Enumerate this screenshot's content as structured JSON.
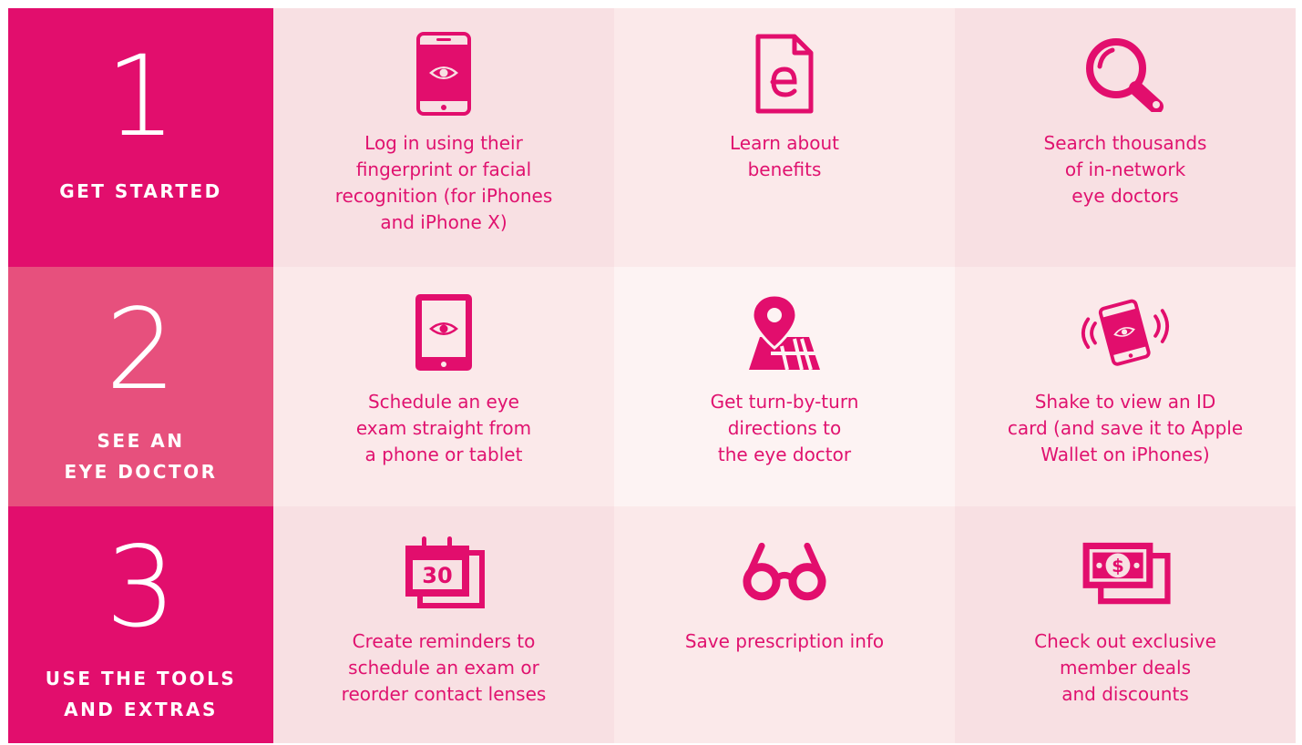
{
  "colors": {
    "accent": "#e20e6d",
    "step_bg_dark": "#e20e6d",
    "step_bg_mid": "#e7507d",
    "cell_a": "#f8e0e3",
    "cell_b": "#fbe9ea",
    "cell_c": "#fdf3f3"
  },
  "steps": [
    {
      "number": "1",
      "title": "GET STARTED"
    },
    {
      "number": "2",
      "title": "SEE AN\nEYE DOCTOR"
    },
    {
      "number": "3",
      "title": "USE THE TOOLS\nAND EXTRAS"
    }
  ],
  "rows": [
    [
      {
        "icon": "phone-eye-icon",
        "text": "Log in using their\nfingerprint or facial\nrecognition (for iPhones\nand iPhone X)"
      },
      {
        "icon": "document-e-icon",
        "text": "Learn about\nbenefits"
      },
      {
        "icon": "magnifier-icon",
        "text": "Search thousands\nof in-network\neye doctors"
      }
    ],
    [
      {
        "icon": "tablet-eye-icon",
        "text": "Schedule an eye\nexam straight from\na phone or tablet"
      },
      {
        "icon": "map-pin-icon",
        "text": "Get turn-by-turn\ndirections to\nthe eye doctor"
      },
      {
        "icon": "shaking-phone-icon",
        "text": "Shake to view an ID\ncard (and save it to Apple\nWallet on iPhones)"
      }
    ],
    [
      {
        "icon": "calendar-icon",
        "calendar_day": "30",
        "text": "Create reminders to\nschedule an exam or\nreorder contact lenses"
      },
      {
        "icon": "glasses-icon",
        "text": "Save prescription info"
      },
      {
        "icon": "money-icon",
        "money_symbol": "$",
        "text": "Check out exclusive\nmember deals\nand discounts"
      }
    ]
  ]
}
